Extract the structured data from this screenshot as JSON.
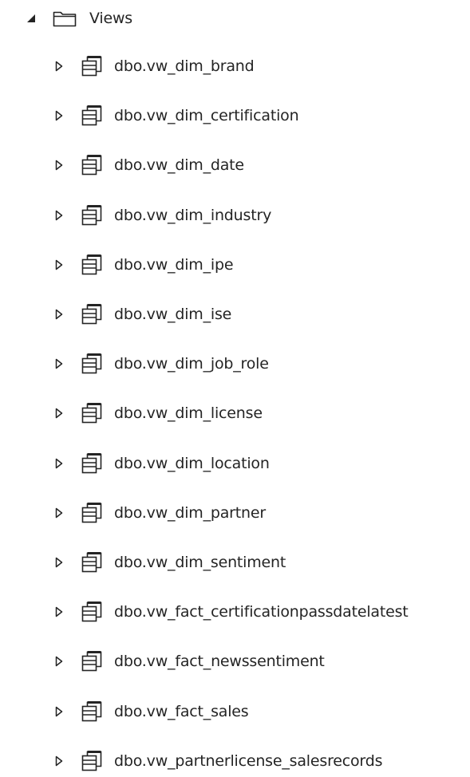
{
  "tree": {
    "folder": {
      "label": "Views",
      "expanded": true,
      "icon": "folder-icon",
      "caret_icon": "caret-expanded-icon"
    },
    "items": [
      {
        "label": "dbo.vw_dim_brand",
        "icon": "view-icon"
      },
      {
        "label": "dbo.vw_dim_certification",
        "icon": "view-icon"
      },
      {
        "label": "dbo.vw_dim_date",
        "icon": "view-icon"
      },
      {
        "label": "dbo.vw_dim_industry",
        "icon": "view-icon"
      },
      {
        "label": "dbo.vw_dim_ipe",
        "icon": "view-icon"
      },
      {
        "label": "dbo.vw_dim_ise",
        "icon": "view-icon"
      },
      {
        "label": "dbo.vw_dim_job_role",
        "icon": "view-icon"
      },
      {
        "label": "dbo.vw_dim_license",
        "icon": "view-icon"
      },
      {
        "label": "dbo.vw_dim_location",
        "icon": "view-icon"
      },
      {
        "label": "dbo.vw_dim_partner",
        "icon": "view-icon"
      },
      {
        "label": "dbo.vw_dim_sentiment",
        "icon": "view-icon"
      },
      {
        "label": "dbo.vw_fact_certificationpassdatelatest",
        "icon": "view-icon"
      },
      {
        "label": "dbo.vw_fact_newssentiment",
        "icon": "view-icon"
      },
      {
        "label": "dbo.vw_fact_sales",
        "icon": "view-icon"
      },
      {
        "label": "dbo.vw_partnerlicense_salesrecords",
        "icon": "view-icon"
      }
    ]
  },
  "colors": {
    "text": "#242424",
    "icon": "#242424",
    "background": "#ffffff"
  }
}
